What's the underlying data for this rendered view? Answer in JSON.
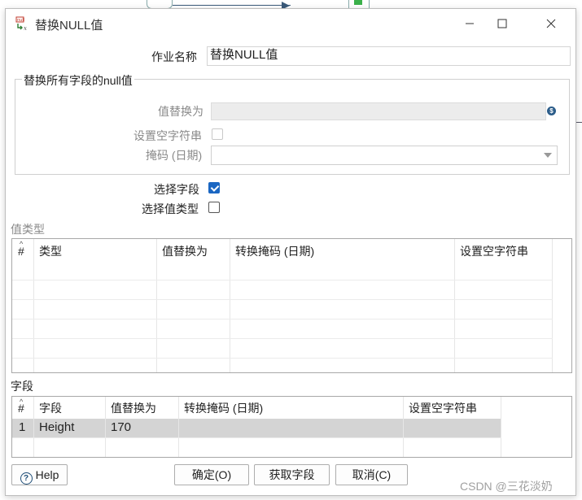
{
  "window": {
    "title": "替换NULL值",
    "icon": "replace-null-icon",
    "controls": [
      "minimize-icon",
      "maximize-icon",
      "close-icon"
    ]
  },
  "form": {
    "job_name_label": "作业名称",
    "job_name_value": "替换NULL值",
    "group_title": "替换所有字段的null值",
    "replace_with_label": "值替换为",
    "replace_with_value": "",
    "set_empty_label": "设置空字符串",
    "set_empty_checked": false,
    "mask_label": "掩码 (日期)",
    "mask_value": "",
    "select_field_label": "选择字段",
    "select_field_checked": true,
    "select_value_type_label": "选择值类型",
    "select_value_type_checked": false
  },
  "value_types": {
    "section_label": "值类型",
    "columns": [
      "#",
      "类型",
      "值替换为",
      "转换掩码 (日期)",
      "设置空字符串"
    ],
    "rows": []
  },
  "fields": {
    "section_label": "字段",
    "columns": [
      "#",
      "字段",
      "值替换为",
      "转换掩码 (日期)",
      "设置空字符串"
    ],
    "rows": [
      {
        "num": "1",
        "field": "Height",
        "replace": "170",
        "mask": "",
        "empty": ""
      }
    ]
  },
  "buttons": {
    "help": "Help",
    "ok": "确定(O)",
    "get_fields": "获取字段",
    "cancel": "取消(C)"
  },
  "watermark": "CSDN @三花淡奶",
  "colors": {
    "accent": "#1a66c2",
    "selected_row": "#d4d4d4",
    "disabled_field": "#ececec"
  }
}
